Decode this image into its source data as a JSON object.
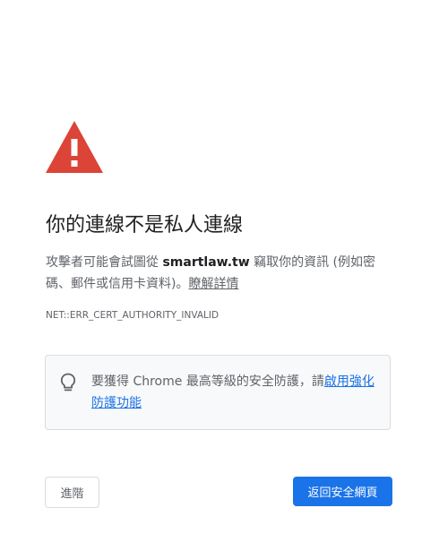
{
  "colors": {
    "warning_red": "#db4437",
    "link_blue": "#1a73e8",
    "text_primary": "#202124",
    "text_secondary": "#5f6368",
    "box_background": "#f8f9fa",
    "border": "#dadce0"
  },
  "icons": {
    "warning": "warning-triangle-icon",
    "tip": "lightbulb-icon"
  },
  "heading": "你的連線不是私人連線",
  "explanation": {
    "before": "攻擊者可能會試圖從 ",
    "domain": "smartlaw.tw",
    "after": " 竊取你的資訊 (例如密碼、郵件或信用卡資料)。",
    "learn_more": "瞭解詳情"
  },
  "error_code": "NET::ERR_CERT_AUTHORITY_INVALID",
  "safe_browsing": {
    "text": "要獲得 Chrome 最高等級的安全防護，請",
    "link": "啟用強化防護功能"
  },
  "buttons": {
    "advanced": "進階",
    "back_to_safety": "返回安全網頁"
  }
}
